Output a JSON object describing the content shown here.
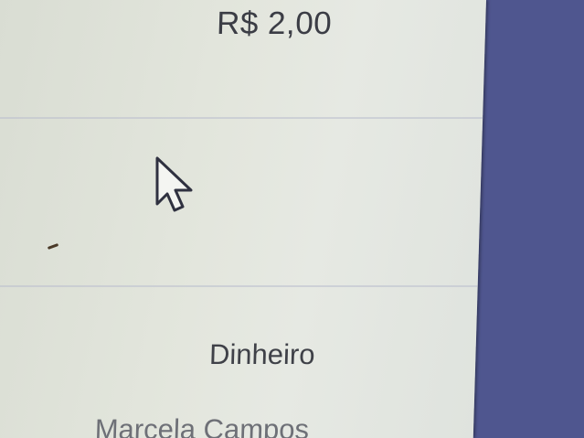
{
  "order": {
    "price": "R$ 2,00",
    "payment_method": "Dinheiro",
    "customer_name": "Marcela Campos"
  },
  "icons": {
    "cursor": "mouse-pointer-icon"
  },
  "colors": {
    "panel_background": "#e3e6dd",
    "sidebar_accent": "#4f568f",
    "text_primary": "#3b3d45",
    "text_muted": "#6e7077"
  }
}
